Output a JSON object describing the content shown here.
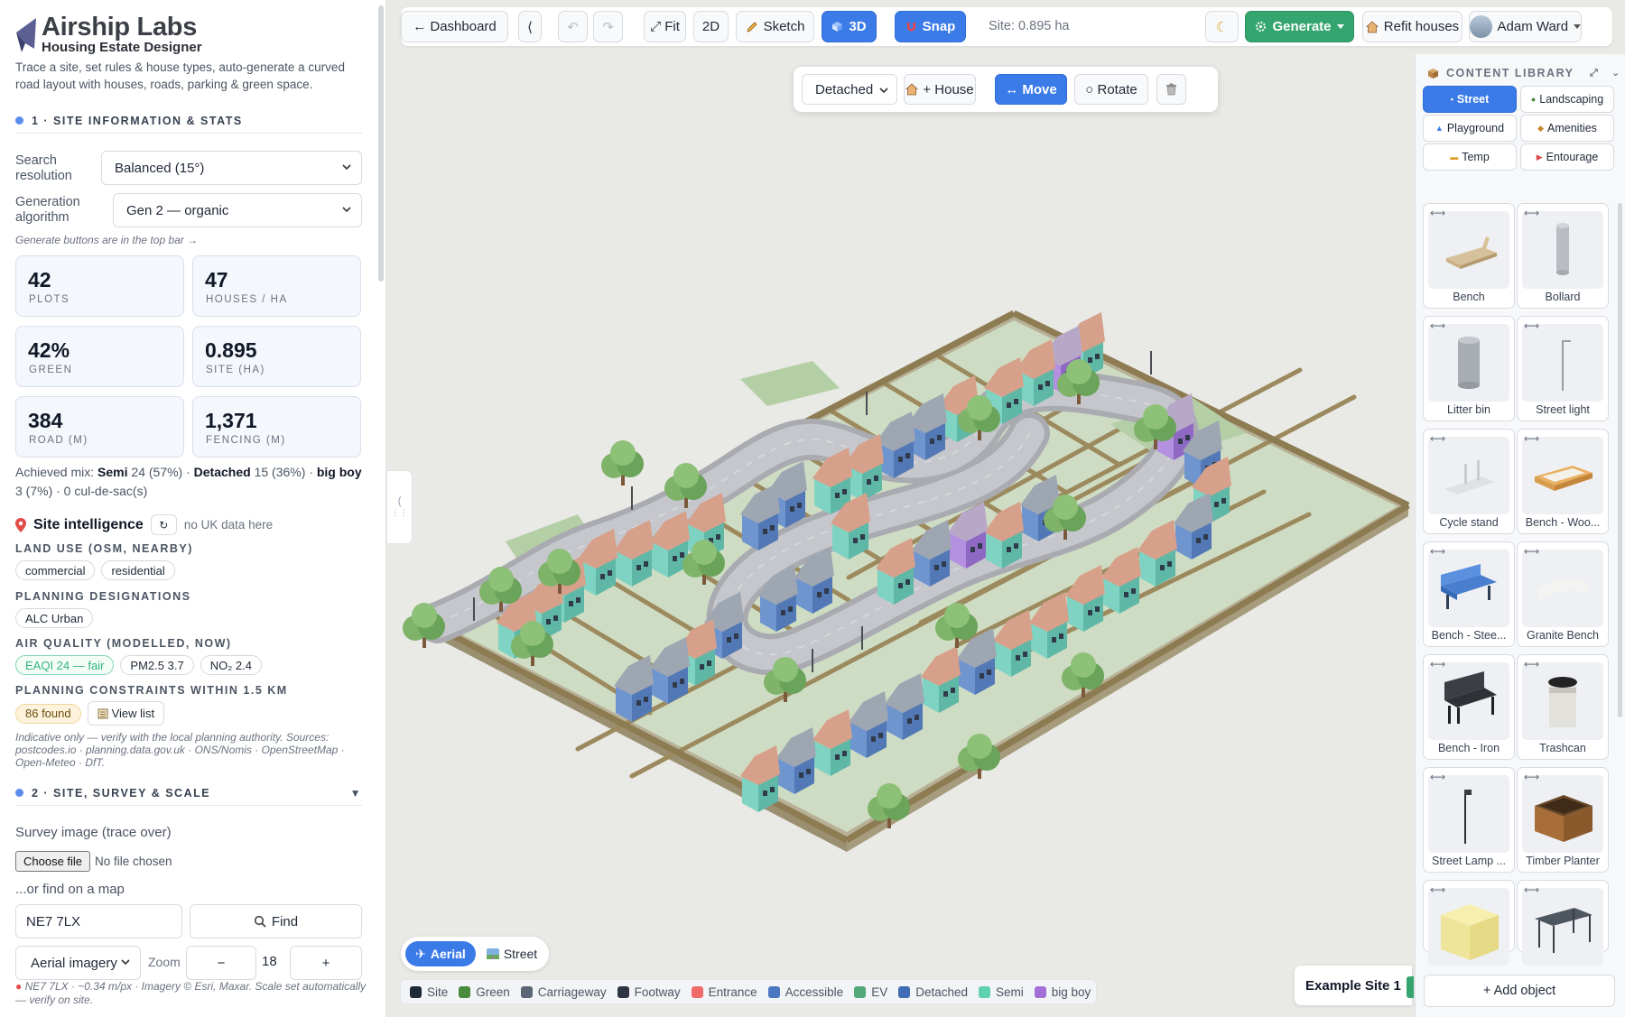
{
  "brand": {
    "title": "Airship Labs",
    "subtitle": "Housing Estate Designer",
    "intro": "Trace a site, set rules & house types, auto-generate a curved road layout with houses, roads, parking & green space."
  },
  "section1": {
    "title": "1 · SITE INFORMATION & STATS"
  },
  "search_resolution": {
    "label": "Search resolution",
    "value": "Balanced (15°)"
  },
  "generation_algorithm": {
    "label": "Generation algorithm",
    "value": "Gen 2 — organic"
  },
  "generate_note": "Generate buttons are in the top bar →",
  "stats": [
    {
      "value": "42",
      "label": "PLOTS"
    },
    {
      "value": "47",
      "label": "HOUSES / HA"
    },
    {
      "value": "42%",
      "label": "GREEN"
    },
    {
      "value": "0.895",
      "label": "SITE (HA)"
    },
    {
      "value": "384",
      "label": "ROAD (M)"
    },
    {
      "value": "1,371",
      "label": "FENCING (M)"
    }
  ],
  "mix": {
    "prefix": "Achieved mix:",
    "semi_label": "Semi",
    "semi_value": "24 (57%) ·",
    "detached_label": "Detached",
    "detached_value": "15 (36%) ·",
    "bigboy_label": "big boy",
    "bigboy_value": "3 (7%) · 0 cul-de-sac(s)"
  },
  "site_intel": {
    "title": "Site intelligence",
    "refresh": "↻",
    "nodata": "no UK data here",
    "land_use_title": "LAND USE (OSM, NEARBY)",
    "land_use": [
      "commercial",
      "residential"
    ],
    "planning_title": "PLANNING DESIGNATIONS",
    "planning": [
      "ALC Urban"
    ],
    "air_title": "AIR QUALITY (MODELLED, NOW)",
    "air": [
      "EAQI 24 — fair",
      "PM2.5 3.7",
      "NO₂ 2.4"
    ],
    "constraints_title": "PLANNING CONSTRAINTS WITHIN 1.5 KM",
    "constraints_found": "86 found",
    "view_list": "View list",
    "sources": "Indicative only — verify with the local planning authority. Sources: postcodes.io · planning.data.gov.uk · ONS/Nomis · OpenStreetMap · Open-Meteo · DfT."
  },
  "section2": {
    "title": "2 · SITE, SURVEY & SCALE",
    "chevron": "▼"
  },
  "survey": {
    "label": "Survey image (trace over)",
    "choose": "Choose file",
    "nofile": "No file chosen",
    "or_map": "...or find on a map",
    "postcode": "NE7 7LX",
    "find": "Find",
    "imagery": "Aerial imagery",
    "zoom_label": "Zoom",
    "zoom_minus": "−",
    "zoom_value": "18",
    "zoom_plus": "+",
    "note": "NE7 7LX · ~0.34 m/px · Imagery © Esri, Maxar. Scale set automatically — verify on site."
  },
  "toolbar": {
    "dashboard": "← Dashboard",
    "collapse": "⟨",
    "undo": "↶",
    "redo": "↷",
    "fit": "⤢ Fit",
    "mode2d": "2D",
    "sketch": "Sketch",
    "mode3d": "3D",
    "snap": "Snap",
    "site": "Site: 0.895 ha",
    "theme": "☾",
    "generate": "Generate",
    "refit": "Refit houses",
    "user": "Adam Ward"
  },
  "floatbar": {
    "house_type": "Detached",
    "add_house": "+ House",
    "move": "↔ Move",
    "rotate": "○ Rotate"
  },
  "viewmode": {
    "aerial": "Aerial",
    "street": "Street"
  },
  "legend": [
    {
      "label": "Site",
      "color": "#1f2937"
    },
    {
      "label": "Green",
      "color": "#4a8a3d"
    },
    {
      "label": "Carriageway",
      "color": "#5b6575"
    },
    {
      "label": "Footway",
      "color": "#2d3544"
    },
    {
      "label": "Entrance",
      "color": "#f06a6a"
    },
    {
      "label": "Accessible",
      "color": "#4a77c0"
    },
    {
      "label": "EV",
      "color": "#52a97a"
    },
    {
      "label": "Detached",
      "color": "#3f6cb4"
    },
    {
      "label": "Semi",
      "color": "#5fd1b0"
    },
    {
      "label": "big boy",
      "color": "#a370d8"
    }
  ],
  "example_site": "Example Site 1",
  "library": {
    "title": "CONTENT LIBRARY",
    "expand": "⤢",
    "menu": "⌄",
    "categories": [
      "Street",
      "Landscaping",
      "Playground",
      "Amenities",
      "Temp",
      "Entourage"
    ],
    "items": [
      "Bench",
      "Bollard",
      "Litter bin",
      "Street light",
      "Cycle stand",
      "Bench - Woo...",
      "Bench - Stee...",
      "Granite Bench",
      "Bench - Iron",
      "Trashcan",
      "Street Lamp ...",
      "Timber Planter",
      "",
      ""
    ],
    "add": "+ Add object"
  }
}
